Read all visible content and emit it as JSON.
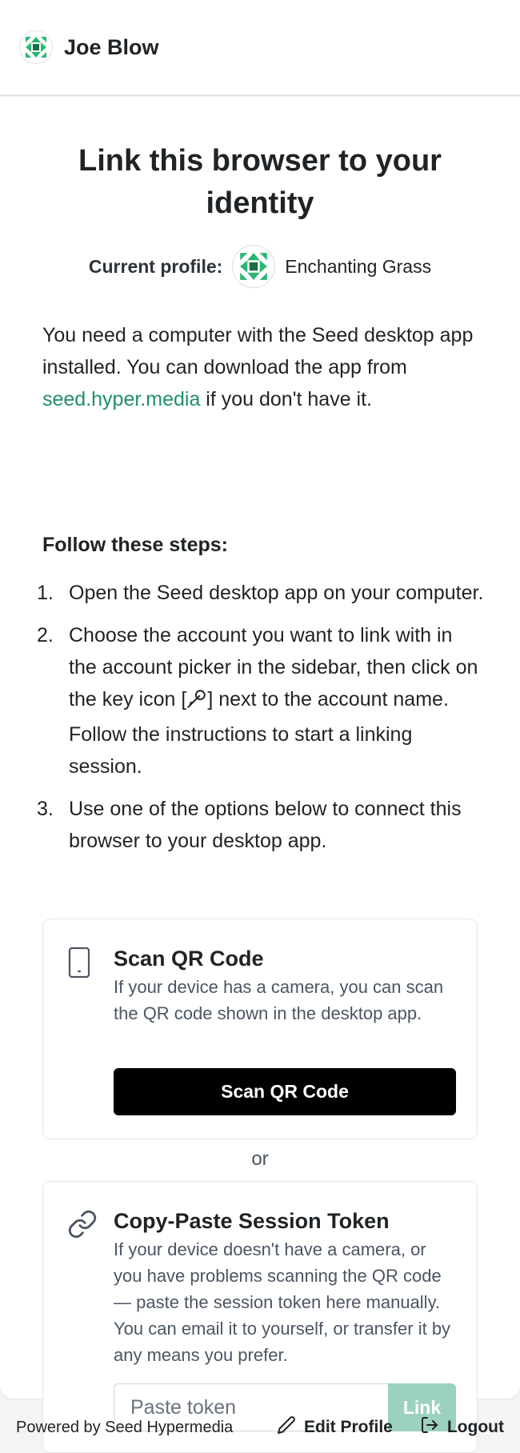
{
  "header": {
    "site_name": "Joe Blow",
    "avatar_icon": "identicon-green"
  },
  "main": {
    "title": "Link this browser to your identity",
    "profile": {
      "label": "Current profile:",
      "name": "Enchanting Grass",
      "avatar_icon": "identicon-green"
    },
    "intro_before": "You need a computer with the Seed desktop app installed. You can download the app from ",
    "intro_link": "seed.hyper.media",
    "intro_after": " if you don't have it.",
    "steps_heading": "Follow these steps:",
    "steps": [
      {
        "num": "1.",
        "text": "Open the Seed desktop app on your computer."
      },
      {
        "num": "2.",
        "text_before": "Choose the account you want to link with in the account picker in the sidebar, then click on the key icon [",
        "text_after": "] next to the account name. Follow the instructions to start a linking session."
      },
      {
        "num": "3.",
        "text": "Use one of the options below to connect this browser to your desktop app."
      }
    ],
    "qr_option": {
      "icon": "phone-icon",
      "title": "Scan QR Code",
      "description": "If your device has a camera, you can scan the QR code shown in the desktop app.",
      "button": "Scan QR Code"
    },
    "or": "or",
    "token_option": {
      "icon": "link-icon",
      "title": "Copy-Paste Session Token",
      "description": "If your device doesn't have a camera, or you have problems scanning the QR code — paste the session token here manually. You can email it to yourself, or transfer it by any means you prefer.",
      "placeholder": "Paste token",
      "button": "Link"
    }
  },
  "footer": {
    "powered": "Powered by Seed Hypermedia",
    "edit_profile": "Edit Profile",
    "logout": "Logout"
  },
  "colors": {
    "accent": "#1f8f6a",
    "link_button_disabled": "#9cd1bf",
    "primary_button": "#000000"
  }
}
